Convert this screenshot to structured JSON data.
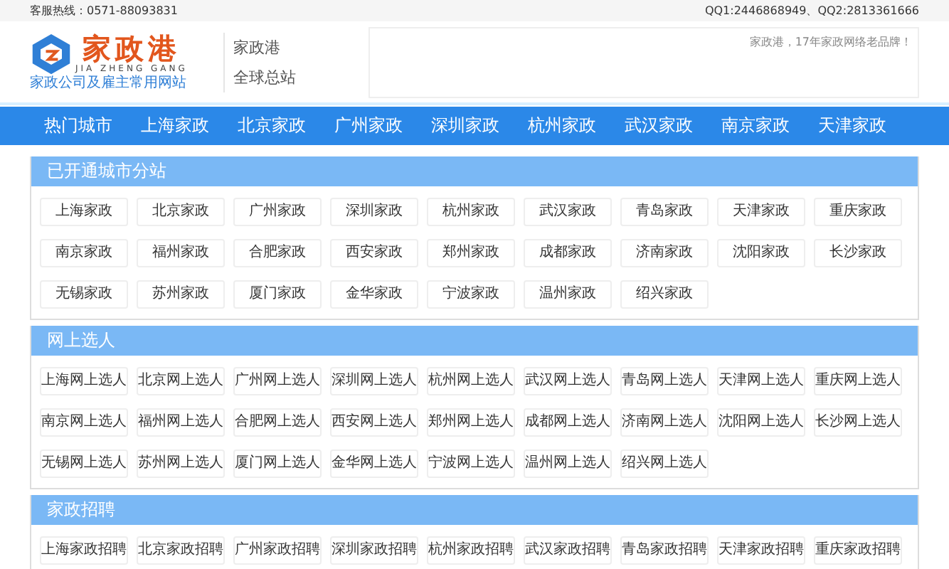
{
  "top_bar": {
    "hotline": "客服热线：0571-88093831",
    "qq": "QQ1:2446868949、QQ2:2813361666"
  },
  "header": {
    "logo": {
      "title": "家政港",
      "pinyin": "JIA ZHENG GANG",
      "tagline": "家政公司及雇主常用网站"
    },
    "site_name": "家政港",
    "site_scope": "全球总站",
    "slogan": "家政港，17年家政网络老品牌！"
  },
  "nav": [
    {
      "label": "热门城市",
      "selected": false
    },
    {
      "label": "上海家政",
      "selected": false
    },
    {
      "label": "北京家政",
      "selected": false
    },
    {
      "label": "广州家政",
      "selected": false
    },
    {
      "label": "深圳家政",
      "selected": false
    },
    {
      "label": "杭州家政",
      "selected": false
    },
    {
      "label": "武汉家政",
      "selected": false
    },
    {
      "label": "南京家政",
      "selected": false
    },
    {
      "label": "天津家政",
      "selected": false
    }
  ],
  "sections": [
    {
      "title": "已开通城市分站",
      "links": [
        "上海家政",
        "北京家政",
        "广州家政",
        "深圳家政",
        "杭州家政",
        "武汉家政",
        "青岛家政",
        "天津家政",
        "重庆家政",
        "南京家政",
        "福州家政",
        "合肥家政",
        "西安家政",
        "郑州家政",
        "成都家政",
        "济南家政",
        "沈阳家政",
        "长沙家政",
        "无锡家政",
        "苏州家政",
        "厦门家政",
        "金华家政",
        "宁波家政",
        "温州家政",
        "绍兴家政"
      ]
    },
    {
      "title": "网上选人",
      "links": [
        "上海网上选人",
        "北京网上选人",
        "广州网上选人",
        "深圳网上选人",
        "杭州网上选人",
        "武汉网上选人",
        "青岛网上选人",
        "天津网上选人",
        "重庆网上选人",
        "南京网上选人",
        "福州网上选人",
        "合肥网上选人",
        "西安网上选人",
        "郑州网上选人",
        "成都网上选人",
        "济南网上选人",
        "沈阳网上选人",
        "长沙网上选人",
        "无锡网上选人",
        "苏州网上选人",
        "厦门网上选人",
        "金华网上选人",
        "宁波网上选人",
        "温州网上选人",
        "绍兴网上选人"
      ]
    },
    {
      "title": "家政招聘",
      "links": [
        "上海家政招聘",
        "北京家政招聘",
        "广州家政招聘",
        "深圳家政招聘",
        "杭州家政招聘",
        "武汉家政招聘",
        "青岛家政招聘",
        "天津家政招聘",
        "重庆家政招聘"
      ]
    }
  ]
}
